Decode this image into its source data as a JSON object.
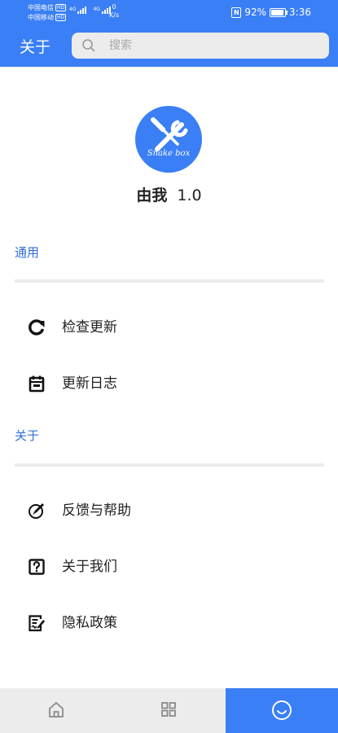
{
  "status_bar": {
    "carrier1": "中国电信",
    "carrier2": "中国移动",
    "hd_badge": "HD",
    "network_tag": "4G",
    "speed_value": "0",
    "speed_unit": "K/s",
    "battery_percent": "92%",
    "battery_level": 0.92,
    "time": "3:36"
  },
  "header": {
    "title": "关于",
    "search_placeholder": "搜索"
  },
  "app_info": {
    "logo_text": "Snake box",
    "name": "由我",
    "version": "1.0"
  },
  "sections": {
    "general_label": "通用",
    "about_label": "关于"
  },
  "menu": {
    "check_update": "检查更新",
    "changelog": "更新日志",
    "feedback": "反馈与帮助",
    "about_us": "关于我们",
    "privacy": "隐私政策"
  },
  "bottom_nav": {
    "tabs": [
      "home-icon",
      "grid-icon",
      "smile-icon"
    ],
    "active_index": 2
  },
  "colors": {
    "primary": "#3a7ff5",
    "section_label": "#2f6fd8",
    "divider": "#ececec",
    "text": "#222222"
  }
}
